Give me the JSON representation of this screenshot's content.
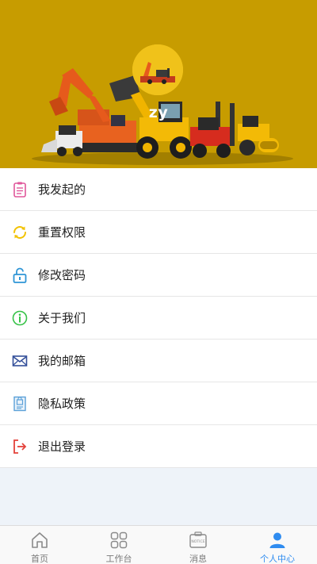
{
  "profile": {
    "username": "zy"
  },
  "menu": {
    "items": [
      {
        "label": "我发起的",
        "icon": "clipboard-icon",
        "color": "#e0579b"
      },
      {
        "label": "重置权限",
        "icon": "refresh-icon",
        "color": "#f2c200"
      },
      {
        "label": "修改密码",
        "icon": "unlock-icon",
        "color": "#2e95d6"
      },
      {
        "label": "关于我们",
        "icon": "info-icon",
        "color": "#36c247"
      },
      {
        "label": "我的邮箱",
        "icon": "mail-icon",
        "color": "#334f99"
      },
      {
        "label": "隐私政策",
        "icon": "privacy-document-icon",
        "color": "#5aa0d8"
      },
      {
        "label": "退出登录",
        "icon": "logout-icon",
        "color": "#e3423a"
      }
    ]
  },
  "tabbar": {
    "tabs": [
      {
        "label": "首页",
        "icon": "home-icon"
      },
      {
        "label": "工作台",
        "icon": "grid-icon"
      },
      {
        "label": "消息",
        "icon": "notice-icon",
        "icon_text": "NOTICE"
      },
      {
        "label": "个人中心",
        "icon": "person-icon",
        "active": true
      }
    ],
    "active_color": "#2f8cf0"
  },
  "colors": {
    "hero_bg": "#c79c00",
    "avatar_bg": "#f0c21a"
  }
}
